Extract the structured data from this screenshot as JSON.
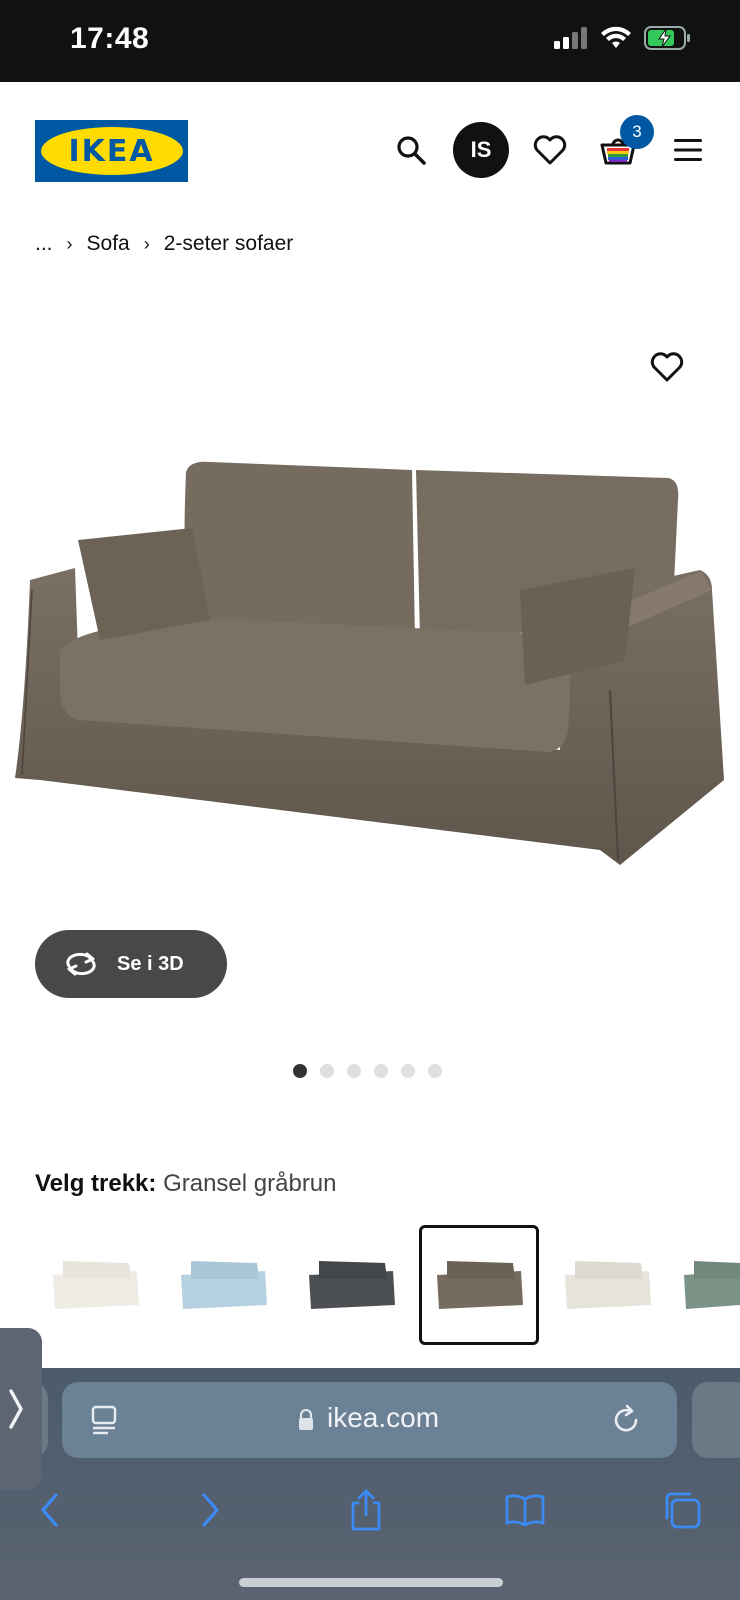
{
  "status_bar": {
    "time": "17:48"
  },
  "header": {
    "logo_text": "IKEA",
    "user_initials": "IS",
    "cart_count": "3",
    "brand_blue": "#0058a3",
    "brand_yellow": "#ffdb00"
  },
  "breadcrumb": [
    "...",
    "Sofa",
    "2-seter sofaer"
  ],
  "product": {
    "view_3d_label": "Se i 3D",
    "image_dots_total": 6,
    "image_dots_active_index": 0,
    "variant_label": "Velg trekk:",
    "variant_value": "Gransel gråbrun",
    "swatches": [
      {
        "color": "#eeece5",
        "selected": false
      },
      {
        "color": "#b6d1df",
        "selected": false
      },
      {
        "color": "#4c5055",
        "selected": false
      },
      {
        "color": "#756b5f",
        "selected": true
      },
      {
        "color": "#e6e3da",
        "selected": false
      },
      {
        "color": "#7c9488",
        "selected": false
      }
    ]
  },
  "browser": {
    "url": "ikea.com"
  },
  "icons": [
    "search-icon",
    "heart-icon",
    "cart-icon",
    "menu-icon",
    "rotate-icon",
    "lock-icon",
    "reload-icon",
    "back-icon",
    "forward-icon",
    "share-icon",
    "bookmarks-icon",
    "tabs-icon"
  ]
}
